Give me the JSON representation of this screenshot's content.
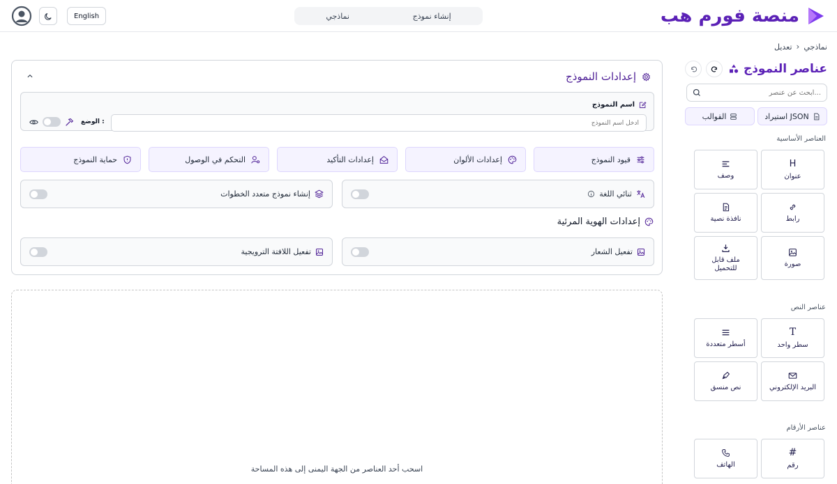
{
  "header": {
    "brand_name": "منصة فورم هب",
    "nav": [
      "إنشاء نموذج",
      "نماذجي"
    ],
    "lang_button": "English",
    "accent": "#5b21b6"
  },
  "breadcrumb": {
    "parent": "نماذجي",
    "current": "تعديل"
  },
  "sidebar": {
    "title": "عناصر النموذج",
    "search_placeholder": "...ابحث عن عنصر",
    "import_json": "JSON استيراد",
    "templates": "القوالب",
    "sections": [
      {
        "label": "العناصر الأساسية",
        "items": [
          "عنوان",
          "وصف",
          "رابط",
          "نافذة نصية",
          "صورة",
          "ملف قابل للتحميل"
        ]
      },
      {
        "label": "عناصر النص",
        "items": [
          "سطر واحد",
          "أسطر متعددة",
          "البريد الإلكتروني",
          "نص منسق"
        ]
      },
      {
        "label": "عناصر الأرقام",
        "items": [
          "رقم",
          "الهاتف"
        ]
      }
    ]
  },
  "settings": {
    "title": "إعدادات النموذج",
    "name_label": "اسم النموذج",
    "name_placeholder": "أدخل اسم النموذج",
    "mode_label": "الوضع :",
    "buttons": [
      "قيود النموذج",
      "إعدادات الألوان",
      "إعدادات التأكيد",
      "التحكم في الوصول",
      "حماية النموذج"
    ],
    "bilingual": "ثنائي اللغة",
    "multistep": "إنشاء نموذج متعدد الخطوات",
    "identity_title": "إعدادات الهوية المرئية",
    "logo_toggle": "تفعيل الشعار",
    "banner_toggle": "تفعيل اللافتة الترويجية"
  },
  "dropzone": {
    "text": "اسحب أحد العناصر من الجهة اليمنى إلى هذه المساحة"
  }
}
